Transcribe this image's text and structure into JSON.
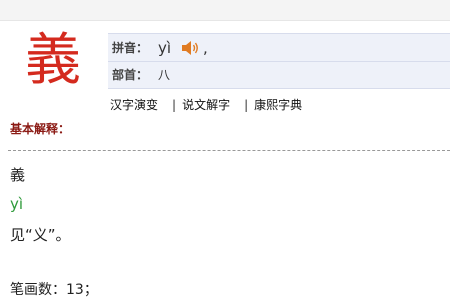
{
  "character": "義",
  "info": {
    "pinyin_label": "拼音：",
    "pinyin_value": "yì",
    "pinyin_suffix": ",",
    "radical_label": "部首：",
    "radical_value": "八"
  },
  "links": {
    "items": [
      "汉字演变",
      "说文解字",
      "康熙字典"
    ],
    "separator": "|"
  },
  "section": {
    "title": "基本解释："
  },
  "definition": {
    "char": "義",
    "pinyin": "yì",
    "meaning": "见“义”。",
    "strokes": "笔画数：13；"
  },
  "colors": {
    "character": "#d42a1e",
    "section_title": "#8b1a14",
    "pinyin_green": "#2e9a3a",
    "info_bg": "#eef1f9",
    "speaker": "#e07b22"
  },
  "icons": {
    "speaker": "speaker-icon"
  }
}
